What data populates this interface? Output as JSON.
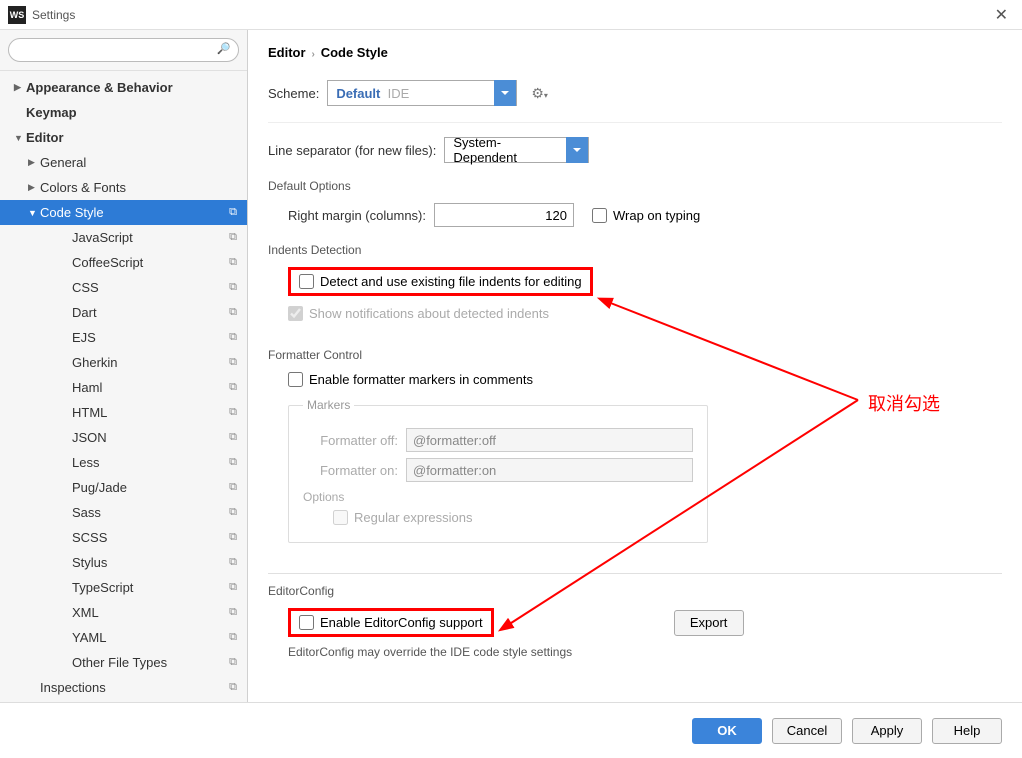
{
  "window": {
    "title": "Settings",
    "icon_text": "WS"
  },
  "sidebar": {
    "search_placeholder": "",
    "items": [
      {
        "label": "Appearance & Behavior",
        "arrow": "▶",
        "bold": true,
        "level": 0
      },
      {
        "label": "Keymap",
        "bold": true,
        "level": 0
      },
      {
        "label": "Editor",
        "arrow": "▼",
        "bold": true,
        "level": 0
      },
      {
        "label": "General",
        "arrow": "▶",
        "level": 1
      },
      {
        "label": "Colors & Fonts",
        "arrow": "▶",
        "level": 1
      },
      {
        "label": "Code Style",
        "arrow": "▼",
        "level": 1,
        "selected": true,
        "copy": true
      },
      {
        "label": "JavaScript",
        "level": 2,
        "copy": true
      },
      {
        "label": "CoffeeScript",
        "level": 2,
        "copy": true
      },
      {
        "label": "CSS",
        "level": 2,
        "copy": true
      },
      {
        "label": "Dart",
        "level": 2,
        "copy": true
      },
      {
        "label": "EJS",
        "level": 2,
        "copy": true
      },
      {
        "label": "Gherkin",
        "level": 2,
        "copy": true
      },
      {
        "label": "Haml",
        "level": 2,
        "copy": true
      },
      {
        "label": "HTML",
        "level": 2,
        "copy": true
      },
      {
        "label": "JSON",
        "level": 2,
        "copy": true
      },
      {
        "label": "Less",
        "level": 2,
        "copy": true
      },
      {
        "label": "Pug/Jade",
        "level": 2,
        "copy": true
      },
      {
        "label": "Sass",
        "level": 2,
        "copy": true
      },
      {
        "label": "SCSS",
        "level": 2,
        "copy": true
      },
      {
        "label": "Stylus",
        "level": 2,
        "copy": true
      },
      {
        "label": "TypeScript",
        "level": 2,
        "copy": true
      },
      {
        "label": "XML",
        "level": 2,
        "copy": true
      },
      {
        "label": "YAML",
        "level": 2,
        "copy": true
      },
      {
        "label": "Other File Types",
        "level": 2,
        "copy": true
      },
      {
        "label": "Inspections",
        "level": 1,
        "copy": true
      }
    ]
  },
  "breadcrumb": {
    "parent": "Editor",
    "current": "Code Style"
  },
  "scheme": {
    "label": "Scheme:",
    "value": "Default",
    "suffix": "IDE"
  },
  "line_sep": {
    "label": "Line separator (for new files):",
    "value": "System-Dependent"
  },
  "default_opts": {
    "title": "Default Options",
    "right_margin_label": "Right margin (columns):",
    "right_margin_value": "120",
    "wrap_label": "Wrap on typing"
  },
  "indents": {
    "title": "Indents Detection",
    "detect_label": "Detect and use existing file indents for editing",
    "notify_label": "Show notifications about detected indents"
  },
  "formatter": {
    "title": "Formatter Control",
    "enable_label": "Enable formatter markers in comments",
    "markers_title": "Markers",
    "off_label": "Formatter off:",
    "off_value": "@formatter:off",
    "on_label": "Formatter on:",
    "on_value": "@formatter:on",
    "options_title": "Options",
    "regex_label": "Regular expressions"
  },
  "editorconfig": {
    "title": "EditorConfig",
    "enable_label": "Enable EditorConfig support",
    "export_label": "Export",
    "note": "EditorConfig may override the IDE code style settings"
  },
  "annotation": {
    "text": "取消勾选"
  },
  "buttons": {
    "ok": "OK",
    "cancel": "Cancel",
    "apply": "Apply",
    "help": "Help"
  }
}
